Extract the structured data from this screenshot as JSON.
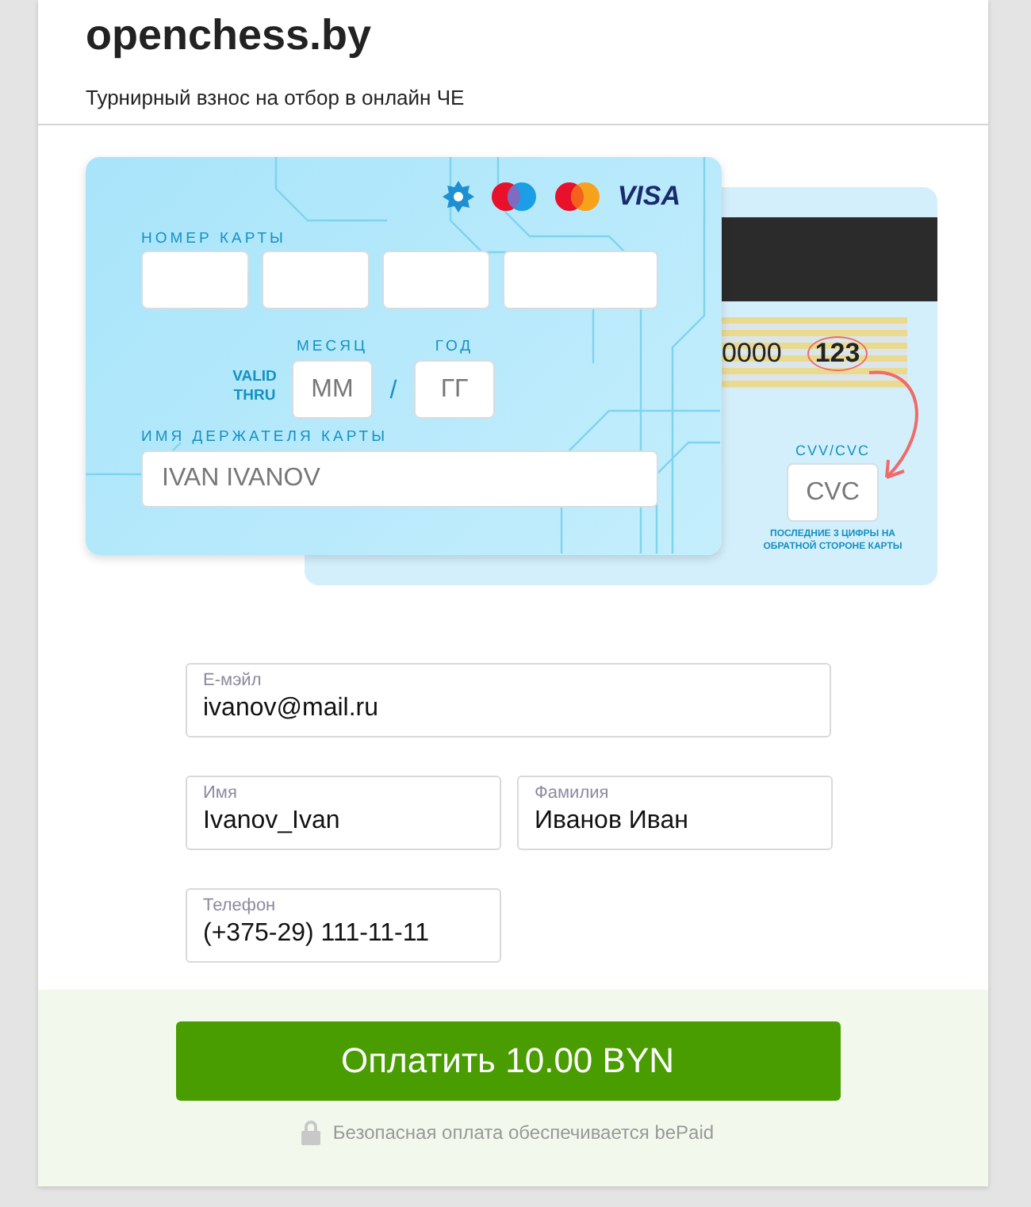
{
  "header": {
    "title": "openchess.by",
    "subtitle": "Турнирный взнос на отбор в онлайн ЧЕ"
  },
  "card_front": {
    "logos": [
      {
        "kind": "belcard"
      },
      {
        "kind": "maestro"
      },
      {
        "kind": "mastercard"
      },
      {
        "kind": "visa",
        "text": "VISA"
      }
    ],
    "number_label": "НОМЕР КАРТЫ",
    "valid_thru": "VALID THRU",
    "month_label": "МЕСЯЦ",
    "year_label": "ГОД",
    "month_placeholder": "ММ",
    "separator": "/",
    "year_placeholder": "ГГ",
    "holder_label": "ИМЯ ДЕРЖАТЕЛЯ КАРТЫ",
    "holder_placeholder": "IVAN IVANOV"
  },
  "card_back": {
    "signature_digits": "0000",
    "cvv_sample": "123",
    "cvv_label": "CVV/CVC",
    "cvv_placeholder": "CVC",
    "cvv_hint": "ПОСЛЕДНИЕ 3 ЦИФРЫ НА ОБРАТНОЙ СТОРОНЕ КАРТЫ"
  },
  "field_rows": [
    [
      {
        "label": "Е-мэйл",
        "value": "ivanov@mail.ru"
      }
    ],
    [
      {
        "label": "Имя",
        "value": "Ivanov_Ivan"
      },
      {
        "label": "Фамилия",
        "value": "Иванов Иван"
      }
    ],
    [
      {
        "label": "Телефон",
        "value": "(+375-29) 111-11-11"
      }
    ]
  ],
  "pay_button": "Оплатить 10.00 BYN",
  "security_note": "Безопасная оплата обеспечивается bePaid"
}
